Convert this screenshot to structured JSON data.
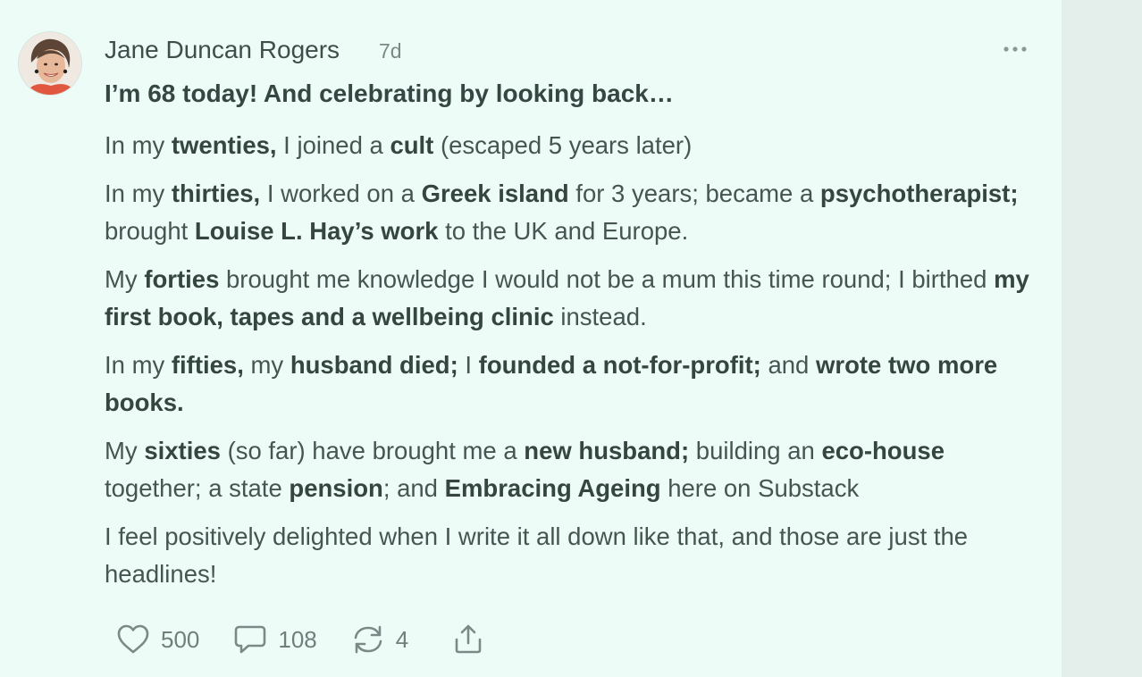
{
  "post": {
    "author": "Jane Duncan Rogers",
    "time": "7d",
    "headline": "I’m 68 today! And celebrating by looking back…",
    "paragraphs": [
      [
        {
          "t": "In my ",
          "b": false
        },
        {
          "t": "twenties,",
          "b": true
        },
        {
          "t": " I joined a ",
          "b": false
        },
        {
          "t": "cult",
          "b": true
        },
        {
          "t": " (escaped 5 years later)",
          "b": false
        }
      ],
      [
        {
          "t": "In my ",
          "b": false
        },
        {
          "t": "thirties,",
          "b": true
        },
        {
          "t": " I worked on a ",
          "b": false
        },
        {
          "t": "Greek island",
          "b": true
        },
        {
          "t": " for 3 years; became a ",
          "b": false
        },
        {
          "t": "psychotherapist;",
          "b": true
        },
        {
          "t": " brought ",
          "b": false
        },
        {
          "t": "Louise L. Hay’s work",
          "b": true
        },
        {
          "t": " to the UK and Europe.",
          "b": false
        }
      ],
      [
        {
          "t": "My ",
          "b": false
        },
        {
          "t": "forties",
          "b": true
        },
        {
          "t": " brought me knowledge I would not be a mum this time round; I birthed ",
          "b": false
        },
        {
          "t": "my first book, tapes and a wellbeing clinic",
          "b": true
        },
        {
          "t": " instead.",
          "b": false
        }
      ],
      [
        {
          "t": "In my ",
          "b": false
        },
        {
          "t": "fifties,",
          "b": true
        },
        {
          "t": " my ",
          "b": false
        },
        {
          "t": "husband died;",
          "b": true
        },
        {
          "t": " I ",
          "b": false
        },
        {
          "t": "founded a not-for-profit;",
          "b": true
        },
        {
          "t": " and ",
          "b": false
        },
        {
          "t": "wrote two more books.",
          "b": true
        }
      ],
      [
        {
          "t": "My ",
          "b": false
        },
        {
          "t": "sixties",
          "b": true
        },
        {
          "t": " (so far) have brought me a ",
          "b": false
        },
        {
          "t": "new husband;",
          "b": true
        },
        {
          "t": " building an ",
          "b": false
        },
        {
          "t": "eco-house",
          "b": true
        },
        {
          "t": " together; a state ",
          "b": false
        },
        {
          "t": "pension",
          "b": true
        },
        {
          "t": "; and ",
          "b": false
        },
        {
          "t": "Embracing Ageing",
          "b": true
        },
        {
          "t": " here on Substack",
          "b": false
        }
      ],
      [
        {
          "t": "I feel positively delighted when I write it all down like that, and those are just the headlines!",
          "b": false
        }
      ]
    ],
    "actions": {
      "likes": "500",
      "comments": "108",
      "restacks": "4"
    }
  },
  "icons": {
    "like": "heart-icon",
    "comment": "speech-bubble-icon",
    "restack": "restack-arrows-icon",
    "share": "share-upload-icon",
    "more": "ellipsis-icon"
  },
  "colors": {
    "post_background": "#eefcf8",
    "page_background": "#e4efec",
    "text_primary": "#34463f",
    "text_muted": "#7a8985"
  }
}
